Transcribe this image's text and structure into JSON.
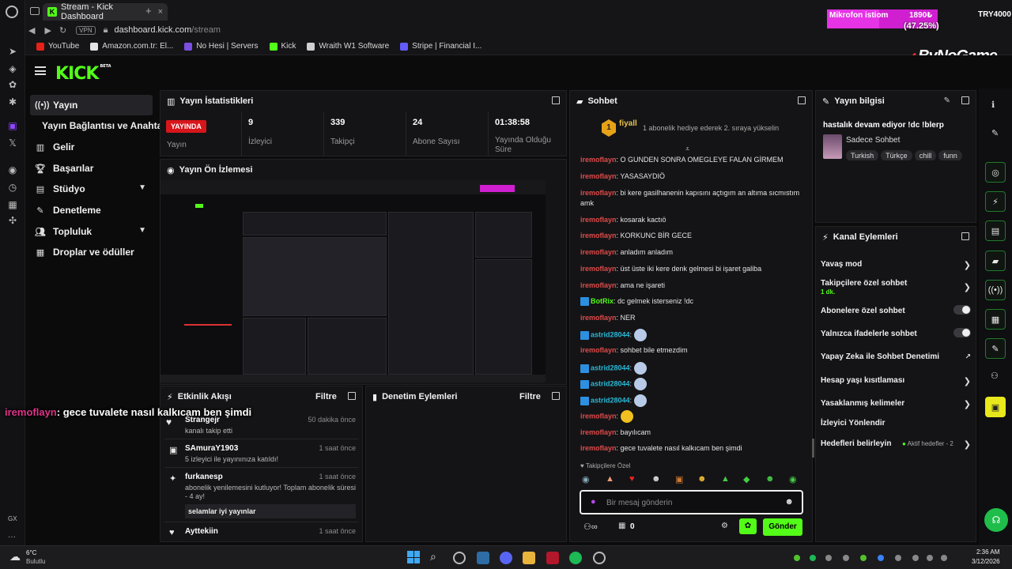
{
  "browser": {
    "tab_title": "Stream - Kick Dashboard",
    "url_host": "dashboard.kick.com",
    "url_path": "/stream",
    "vpn": "VPN",
    "bookmarks": [
      {
        "label": "YouTube",
        "color": "#e62117"
      },
      {
        "label": "Amazon.com.tr: El...",
        "color": "#e4e4e4"
      },
      {
        "label": "No Hesi | Servers",
        "color": "#7b4de0"
      },
      {
        "label": "Kick",
        "color": "#53fc18"
      },
      {
        "label": "Wraith W1 Software",
        "color": "#cfcfcf"
      },
      {
        "label": "Stripe | Financial I...",
        "color": "#635bff"
      }
    ],
    "opera_label": "GX"
  },
  "overlay": {
    "mic_label": "Mikrofon istiom",
    "mic_value": "1890₺",
    "mic_pct": "(47.25%)",
    "target": "TRY4000",
    "progress": 0.4725,
    "brand": "ByNoGame",
    "chat_user": "iremoflayn",
    "chat_text": ": gece tuvalete nasıl kalkıcam ben şimdi"
  },
  "kick": {
    "logo": "KICK",
    "beta": "BETA"
  },
  "nav": [
    {
      "label": "Yayın",
      "icon": "broadcast-icon"
    },
    {
      "label": "Yayın Bağlantısı ve Anahtarı",
      "icon": "key-icon"
    },
    {
      "label": "Gelir",
      "icon": "chart-icon"
    },
    {
      "label": "Başarılar",
      "icon": "trophy-icon"
    },
    {
      "label": "Stüdyo",
      "icon": "studio-icon"
    },
    {
      "label": "Denetleme",
      "icon": "wrench-icon"
    },
    {
      "label": "Topluluk",
      "icon": "people-icon"
    },
    {
      "label": "Droplar ve ödüller",
      "icon": "gift-icon"
    }
  ],
  "stats": {
    "title": "Yayın İstatistikleri",
    "live_badge": "YAYINDA",
    "items": [
      {
        "value": "",
        "label": "Yayın"
      },
      {
        "value": "9",
        "label": "İzleyici"
      },
      {
        "value": "339",
        "label": "Takipçi"
      },
      {
        "value": "24",
        "label": "Abone Sayısı"
      },
      {
        "value": "01:38:58",
        "label": "Yayında Olduğu Süre"
      }
    ]
  },
  "preview": {
    "title": "Yayın Ön İzlemesi"
  },
  "activity": {
    "title": "Etkinlik Akışı",
    "filter": "Filtre",
    "items": [
      {
        "name": "Strangejr",
        "time": "50 dakika önce",
        "sub": "kanalı takip etti"
      },
      {
        "name": "SAmuraY1903",
        "time": "1 saat önce",
        "sub": "5 izleyici ile yayınınıza katıldı!"
      },
      {
        "name": "furkanesp",
        "time": "1 saat önce",
        "sub": "abonelik yenilemesini kutluyor! Toplam abonelik süresi - 4 ay!",
        "msg": "selamlar iyi yayınlar"
      },
      {
        "name": "Ayttekiin",
        "time": "1 saat önce",
        "sub": ""
      }
    ]
  },
  "mod": {
    "title": "Denetim Eylemleri",
    "filter": "Filtre"
  },
  "chat": {
    "title": "Sohbet",
    "pinned_user": "fiyall",
    "pinned_count": "1",
    "pinned_text": "1 abonelik hediye ederek 2. sıraya yükselin",
    "messages": [
      {
        "user": "iremoflayn",
        "text": ": O GUNDEN SONRA OMEGLEYE FALAN GİRMEM",
        "style": "u"
      },
      {
        "user": "iremoflayn",
        "text": ": YASASAYDIÖ",
        "style": "u"
      },
      {
        "user": "iremoflayn",
        "text": ": bi kere gasilhanenin kapısını açtıgım an altıma sıcmıstım amk",
        "style": "u"
      },
      {
        "user": "iremoflayn",
        "text": ": kosarak kactıö",
        "style": "u"
      },
      {
        "user": "iremoflayn",
        "text": ": KORKUNC BİR GECE",
        "style": "u"
      },
      {
        "user": "iremoflayn",
        "text": ": anladım anladım",
        "style": "u"
      },
      {
        "user": "iremoflayn",
        "text": ": üst üste iki kere denk gelmesi bi işaret galiba",
        "style": "u"
      },
      {
        "user": "iremoflayn",
        "text": ": ama ne işareti",
        "style": "u"
      },
      {
        "user": "BotRix",
        "text": ": dc gelmek isterseniz !dc",
        "style": "ug"
      },
      {
        "user": "iremoflayn",
        "text": ": NER",
        "style": "u"
      },
      {
        "user": "astrid28044",
        "text": ":",
        "style": "ut"
      },
      {
        "user": "iremoflayn",
        "text": ": sohbet bile etmezdim",
        "style": "u"
      },
      {
        "user": "astrid28044",
        "text": ":",
        "style": "ut"
      },
      {
        "user": "astrid28044",
        "text": ":",
        "style": "ut"
      },
      {
        "user": "astrid28044",
        "text": ":",
        "style": "ut"
      },
      {
        "user": "iremoflayn",
        "text": ":",
        "style": "u"
      },
      {
        "user": "iremoflayn",
        "text": ": bayılıcam",
        "style": "u"
      },
      {
        "user": "iremoflayn",
        "text": ": gece tuvalete nasıl kalkıcam ben şimdi",
        "style": "u"
      }
    ],
    "followers_only": "Takipçilere Özel",
    "placeholder": "Bir mesaj gönderin",
    "points": "0",
    "send": "Gönder"
  },
  "info": {
    "title": "Yayın bilgisi",
    "stream_title": "hastalık devam ediyor !dc !blerp",
    "category": "Sadece Sohbet",
    "tags": [
      "Turkish",
      "Türkçe",
      "chill",
      "funn"
    ]
  },
  "channel": {
    "title": "Kanal Eylemleri",
    "items": [
      {
        "label": "Yavaş mod",
        "type": "chevron"
      },
      {
        "label": "Takipçilere özel sohbet",
        "sub": "1 dk.",
        "type": "chevron"
      },
      {
        "label": "Abonelere özel sohbet",
        "type": "toggle"
      },
      {
        "label": "Yalnızca ifadelerle sohbet",
        "type": "toggle"
      },
      {
        "label": "Yapay Zeka ile Sohbet Denetimi",
        "type": "external"
      },
      {
        "label": "Hesap yaşı kısıtlaması",
        "type": "chevron"
      },
      {
        "label": "Yasaklanmış kelimeler",
        "type": "chevron"
      },
      {
        "label": "İzleyici Yönlendir",
        "type": "none"
      },
      {
        "label": "Hedefleri belirleyin",
        "extra": "Aktif hedefler - 2",
        "type": "chevron"
      }
    ]
  },
  "taskbar": {
    "weather_temp": "6°C",
    "weather_desc": "Bulutlu",
    "time": "2:36 AM",
    "date": "3/12/2026"
  }
}
